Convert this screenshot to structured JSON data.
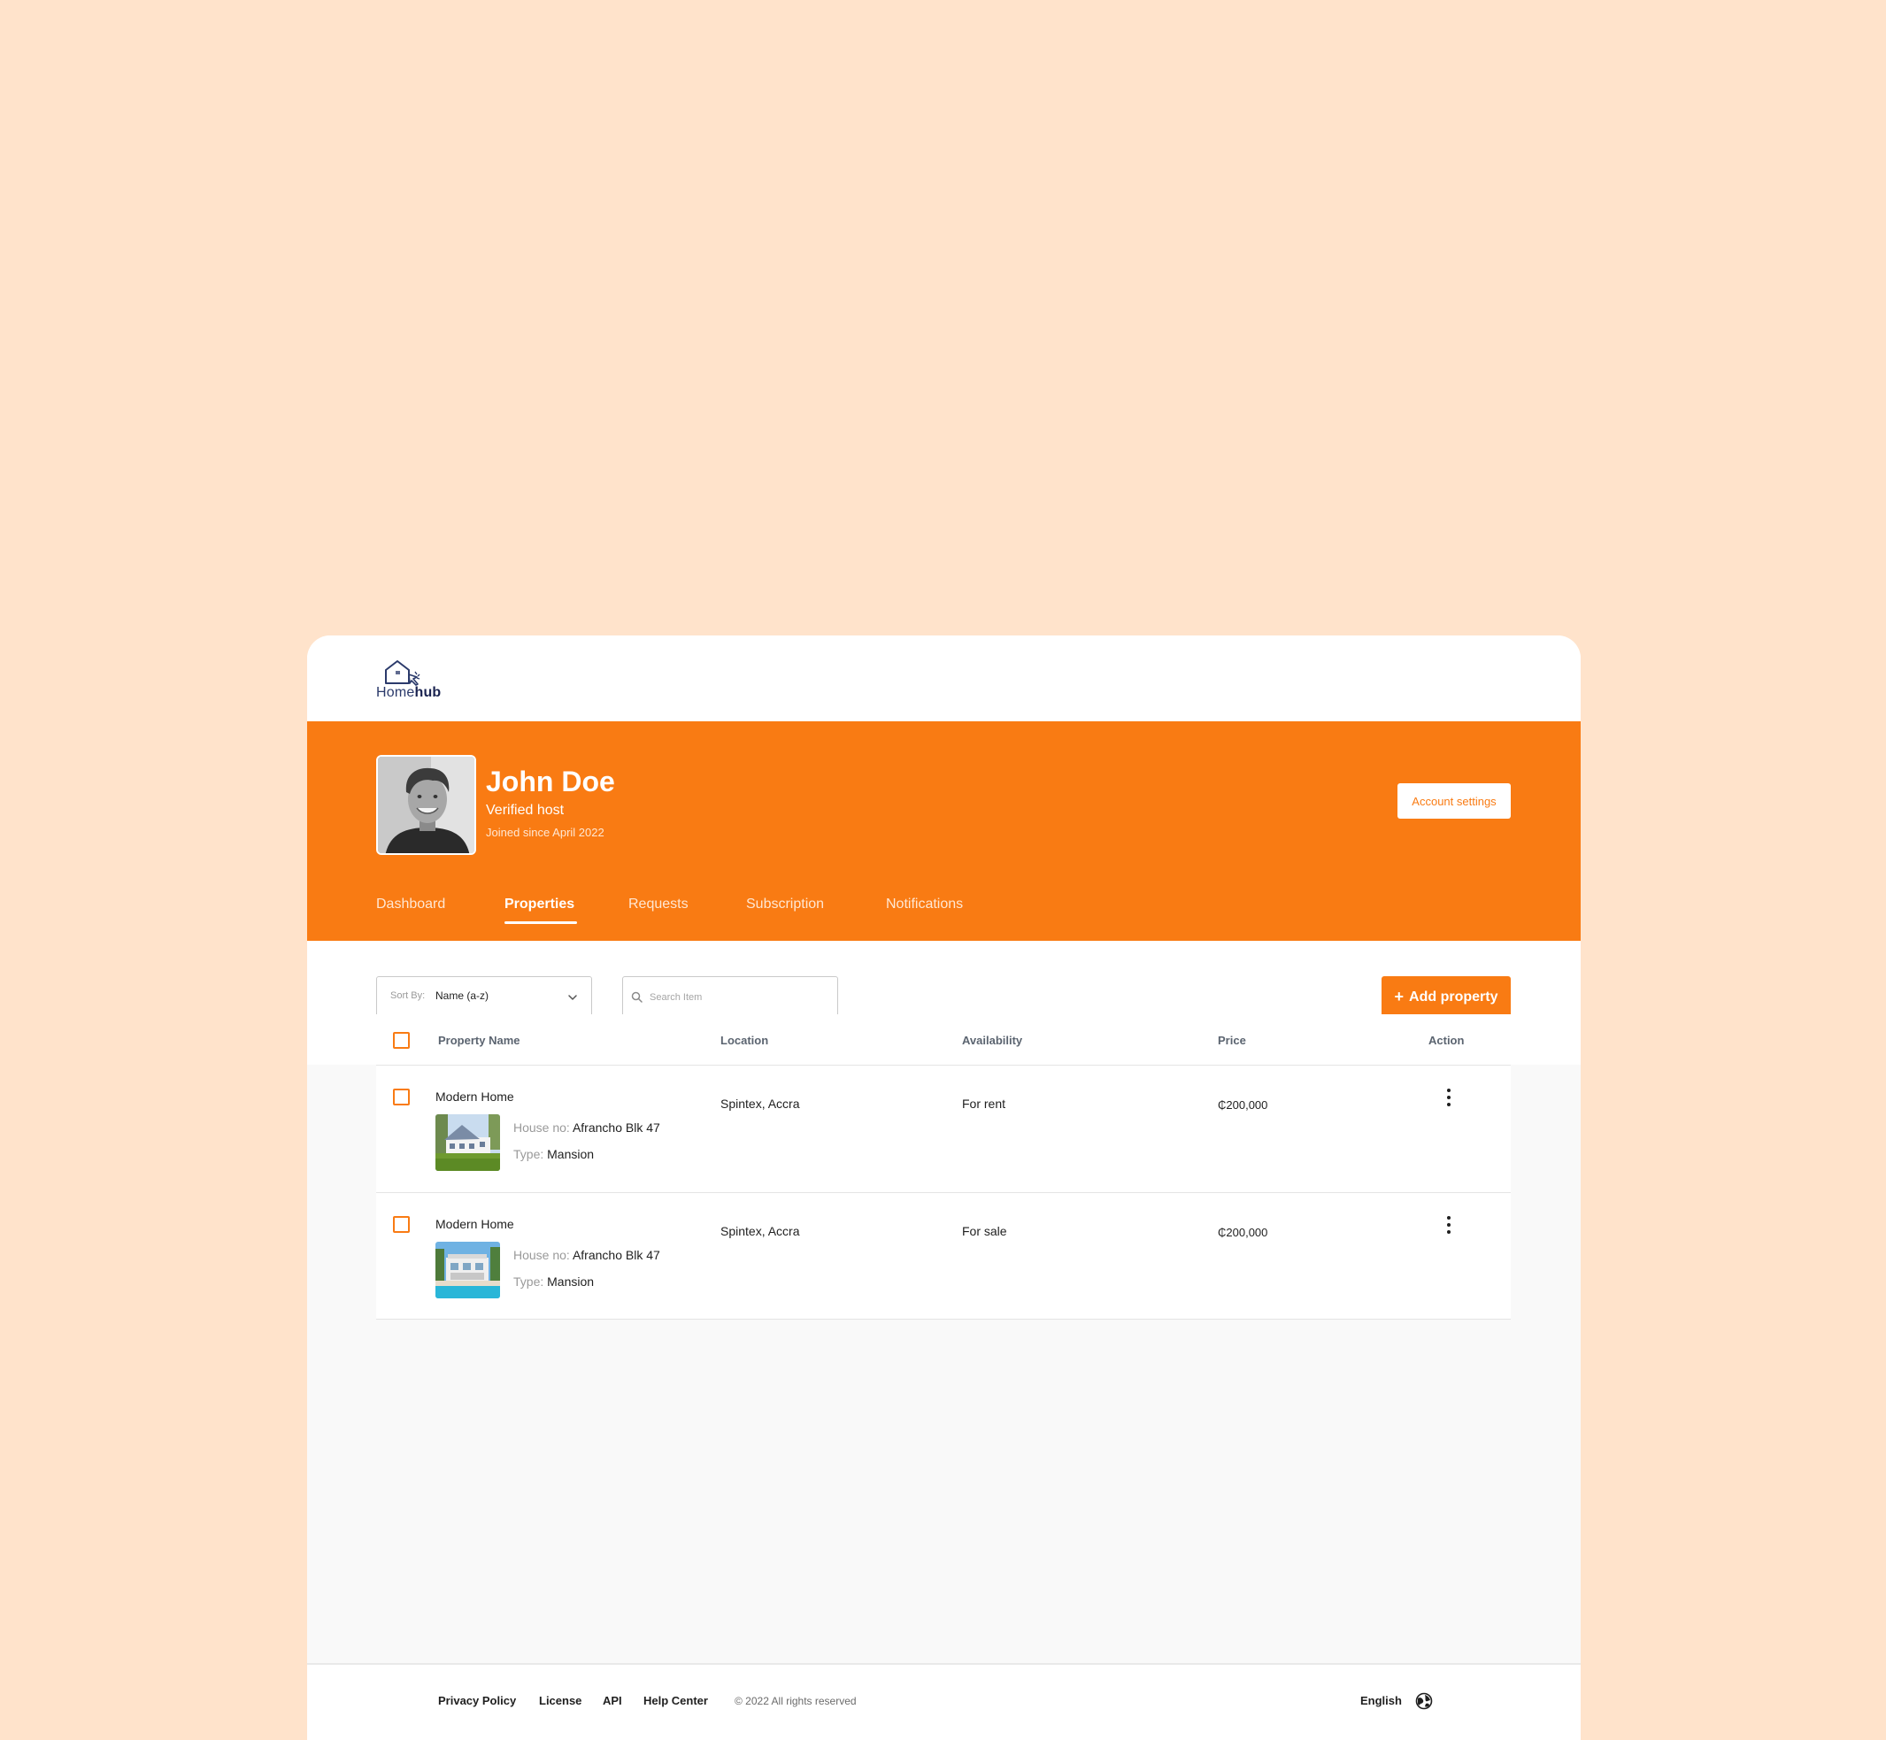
{
  "brand": {
    "name_regular": "Home",
    "name_bold": "hub",
    "logo_icon": "house-cursor-logo-icon",
    "accent_color": "#F97B13",
    "background_color": "#FFE3CB"
  },
  "profile": {
    "name": "John Doe",
    "role": "Verified host",
    "joined": "Joined since April 2022",
    "account_button": "Account settings"
  },
  "tabs": [
    {
      "label": "Dashboard",
      "active": false
    },
    {
      "label": "Properties",
      "active": true
    },
    {
      "label": "Requests",
      "active": false
    },
    {
      "label": "Subscription",
      "active": false
    },
    {
      "label": "Notifications",
      "active": false
    }
  ],
  "toolbar": {
    "sort_label": "Sort By:",
    "sort_value": "Name (a-z)",
    "search_placeholder": "Search Item",
    "add_button": "Add property",
    "add_icon": "+"
  },
  "table": {
    "columns": [
      "Property Name",
      "Location",
      "Availability",
      "Price",
      "Action"
    ],
    "rows": [
      {
        "name": "Modern Home",
        "house_no_label": "House no:",
        "house_no": "Afrancho Blk 47",
        "type_label": "Type:",
        "type": "Mansion",
        "location": "Spintex, Accra",
        "availability": "For rent",
        "price": "₵200,000",
        "thumbnail": "house-with-lawn"
      },
      {
        "name": "Modern Home",
        "house_no_label": "House no:",
        "house_no": "Afrancho Blk 47",
        "type_label": "Type:",
        "type": "Mansion",
        "location": "Spintex, Accra",
        "availability": "For sale",
        "price": "₵200,000",
        "thumbnail": "house-with-pool"
      }
    ]
  },
  "footer": {
    "links": [
      "Privacy Policy",
      "License",
      "API",
      "Help Center"
    ],
    "copyright": "© 2022 All rights reserved",
    "language": "English",
    "language_icon": "globe-icon"
  }
}
